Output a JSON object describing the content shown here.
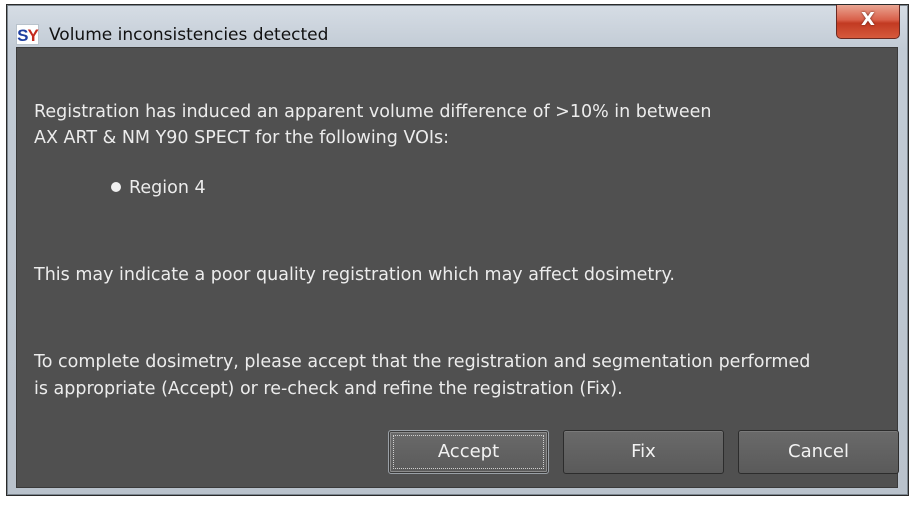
{
  "window": {
    "title": "Volume inconsistencies detected",
    "app_icon": "SY",
    "close_label": "X"
  },
  "message": {
    "line1": "Registration has induced an apparent volume difference of >10% in between",
    "line2": "AX ART & NM Y90 SPECT for the following VOIs:",
    "vois": [
      "Region 4"
    ],
    "warning": "This may indicate a poor quality registration which may affect dosimetry.",
    "instruction1": "To complete dosimetry, please accept that the registration and segmentation performed",
    "instruction2": "is appropriate (Accept) or re-check and refine the registration (Fix)."
  },
  "buttons": {
    "accept": "Accept",
    "fix": "Fix",
    "cancel": "Cancel"
  },
  "colors": {
    "dialog_background": "#505050",
    "text": "#ececec",
    "close_button": "#c94a32"
  }
}
